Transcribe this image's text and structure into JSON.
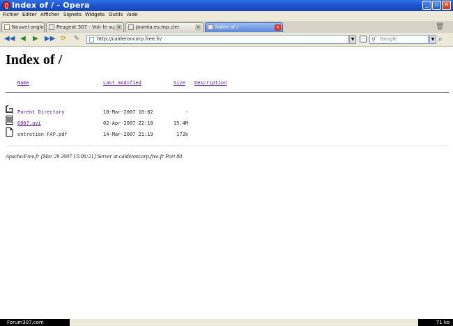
{
  "window": {
    "title": "Index of / - Opera"
  },
  "menu": [
    "Fichier",
    "Editer",
    "Afficher",
    "Signets",
    "Widgets",
    "Outils",
    "Aide"
  ],
  "tabs": [
    {
      "label": "Nouvel onglet",
      "active": false
    },
    {
      "label": "Peugeot 307 - Voir le suj...",
      "active": false
    },
    {
      "label": "Joomla.es.mp.cler",
      "active": false
    },
    {
      "label": "Index of /",
      "active": true
    }
  ],
  "address": {
    "url": "http://calderoncorp.free.fr/"
  },
  "search": {
    "placeholder": "Google"
  },
  "page": {
    "title": "Index of /",
    "columns": {
      "name": "Name",
      "modified": "Last modified",
      "size": "Size",
      "description": "Description"
    },
    "rows": [
      {
        "icon": "back-arrow-icon",
        "name": "Parent Directory",
        "modified": "10-Mar-2007 10:02",
        "size": "-",
        "link_style": "plain-link"
      },
      {
        "icon": "compressed-file-icon",
        "name": "6007.avi",
        "modified": "02-Apr-2007 22:18",
        "size": "15.4M",
        "link_style": "underline"
      },
      {
        "icon": "document-icon",
        "name": "entretien-FAP.pdf",
        "modified": "14-Mar-2007 21:19",
        "size": "172k",
        "link_style": "none"
      }
    ],
    "server_signature": "Apache/Free.fr [Mar 29 2007 15:06:21] Server at calderoncorp.free.fr Port 80"
  },
  "status": {
    "left": "Forum307.com",
    "right": "71 ko"
  },
  "colors": {
    "titlebar": "#1b4fc7",
    "visited_link": "#551a8b",
    "active_tab": "#5c87dc"
  }
}
